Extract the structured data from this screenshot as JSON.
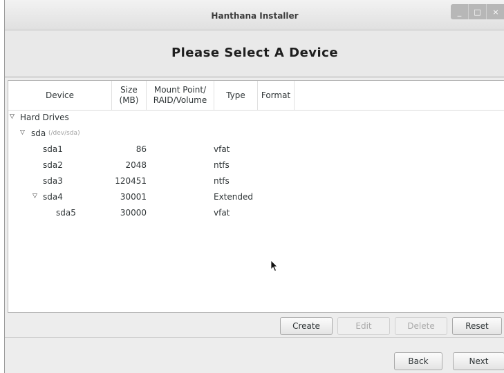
{
  "window": {
    "title": "Hanthana Installer",
    "controls": {
      "minimize": "_",
      "maximize": "□",
      "close": "×"
    }
  },
  "header": {
    "title": "Please Select A Device"
  },
  "table": {
    "columns": [
      {
        "label": "Device"
      },
      {
        "label": "Size\n(MB)"
      },
      {
        "label": "Mount Point/\nRAID/Volume"
      },
      {
        "label": "Type"
      },
      {
        "label": "Format"
      }
    ],
    "rows": [
      {
        "device": "Hard Drives",
        "expander": "▽",
        "size": "",
        "type": ""
      },
      {
        "device": "sda",
        "detail": "(/dev/sda)",
        "expander": "▽",
        "size": "",
        "type": ""
      },
      {
        "device": "sda1",
        "size": "86",
        "type": "vfat"
      },
      {
        "device": "sda2",
        "size": "2048",
        "type": "ntfs"
      },
      {
        "device": "sda3",
        "size": "120451",
        "type": "ntfs"
      },
      {
        "device": "sda4",
        "expander": "▽",
        "size": "30001",
        "type": "Extended"
      },
      {
        "device": "sda5",
        "size": "30000",
        "type": "vfat"
      }
    ]
  },
  "actions": {
    "create": "Create",
    "edit": "Edit",
    "delete": "Delete",
    "reset": "Reset"
  },
  "nav": {
    "back": "Back",
    "next": "Next"
  }
}
